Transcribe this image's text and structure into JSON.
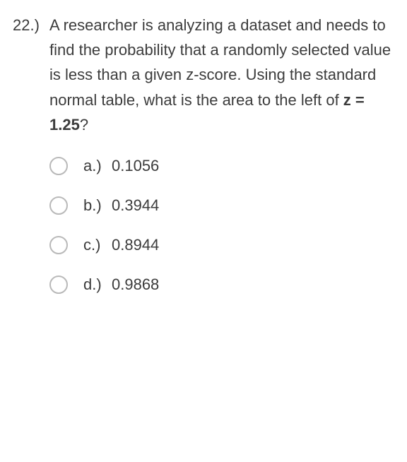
{
  "question": {
    "number": "22.)",
    "stem_pre": "A researcher is analyzing a dataset and needs to find the probability that a randomly selected value is less than a given z-score. Using the standard normal table, what is the area to the left of ",
    "stem_bold": "z = 1.25",
    "stem_post": "?"
  },
  "options": [
    {
      "letter": "a.)",
      "text": "0.1056"
    },
    {
      "letter": "b.)",
      "text": "0.3944"
    },
    {
      "letter": "c.)",
      "text": "0.8944"
    },
    {
      "letter": "d.)",
      "text": "0.9868"
    }
  ]
}
